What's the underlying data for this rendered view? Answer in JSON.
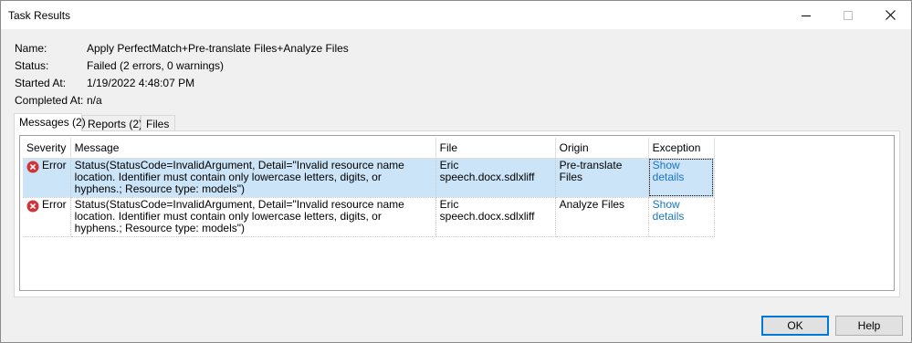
{
  "window": {
    "title": "Task Results"
  },
  "info": {
    "name_label": "Name:",
    "name_value": "Apply PerfectMatch+Pre-translate Files+Analyze Files",
    "status_label": "Status:",
    "status_value": "Failed (2 errors, 0 warnings)",
    "started_label": "Started At:",
    "started_value": "1/19/2022 4:48:07 PM",
    "completed_label": "Completed At:",
    "completed_value": "n/a"
  },
  "tabs": [
    {
      "label": "Messages (2)",
      "active": true
    },
    {
      "label": "Reports (2)",
      "active": false
    },
    {
      "label": "Files",
      "active": false
    }
  ],
  "grid": {
    "columns": [
      "Severity",
      "Message",
      "File",
      "Origin",
      "Exception"
    ],
    "rows": [
      {
        "severity": "Error",
        "message": "Status(StatusCode=InvalidArgument, Detail=\"Invalid resource name location. Identifier must contain only lowercase letters, digits, or hyphens.;  Resource type: models\")",
        "file": "Eric speech.docx.sdlxliff",
        "origin": "Pre-translate Files",
        "exception": "Show details",
        "selected": true
      },
      {
        "severity": "Error",
        "message": "Status(StatusCode=InvalidArgument, Detail=\"Invalid resource name location. Identifier must contain only lowercase letters, digits, or hyphens.;  Resource type: models\")",
        "file": "Eric speech.docx.sdlxliff",
        "origin": "Analyze Files",
        "exception": "Show details",
        "selected": false
      }
    ]
  },
  "buttons": {
    "ok": "OK",
    "help": "Help"
  },
  "colors": {
    "selection": "#cce4f7",
    "link": "#1a74c6",
    "error": "#d13438",
    "focus_border": "#0078d7"
  },
  "icons": {
    "severity": "error-icon",
    "minimize": "minimize-icon",
    "maximize": "maximize-icon",
    "close": "close-icon"
  }
}
